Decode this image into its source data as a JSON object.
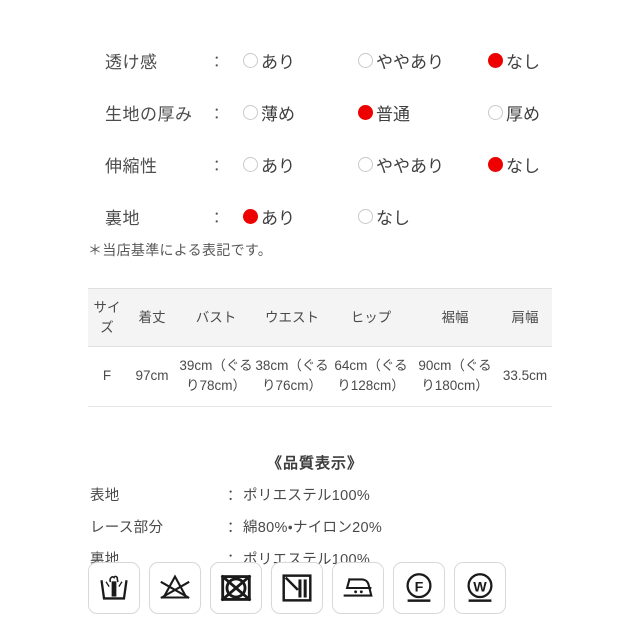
{
  "attributes": [
    {
      "name": "sheerness",
      "label": "透け感",
      "colon": "：",
      "options": [
        {
          "text": "あり",
          "selected": false
        },
        {
          "text": "ややあり",
          "selected": false
        },
        {
          "text": "なし",
          "selected": true
        }
      ]
    },
    {
      "name": "thickness",
      "label": "生地の厚み",
      "colon": "：",
      "options": [
        {
          "text": "薄め",
          "selected": false
        },
        {
          "text": "普通",
          "selected": true
        },
        {
          "text": "厚め",
          "selected": false
        }
      ]
    },
    {
      "name": "stretch",
      "label": "伸縮性",
      "colon": "：",
      "options": [
        {
          "text": "あり",
          "selected": false
        },
        {
          "text": "ややあり",
          "selected": false
        },
        {
          "text": "なし",
          "selected": true
        }
      ]
    },
    {
      "name": "lining",
      "label": "裏地",
      "colon": "：",
      "options": [
        {
          "text": "あり",
          "selected": true
        },
        {
          "text": "なし",
          "selected": false
        }
      ]
    }
  ],
  "footnote": "＊当店基準による表記です。",
  "size_table": {
    "headers": [
      "サイズ",
      "着丈",
      "バスト",
      "ウエスト",
      "ヒップ",
      "裾幅",
      "肩幅"
    ],
    "rows": [
      [
        "F",
        "97cm",
        "39cm（ぐるり78cm）",
        "38cm（ぐるり76cm）",
        "64cm（ぐるり128cm）",
        "90cm（ぐるり180cm）",
        "33.5cm"
      ]
    ]
  },
  "quality": {
    "title": "《品質表示》",
    "rows": [
      {
        "label": "表地",
        "colon": "：",
        "value": "ポリエステル100%"
      },
      {
        "label": "レース部分",
        "colon": "：",
        "value": "綿80%・ナイロン20%"
      },
      {
        "label": "裏地",
        "colon": "：",
        "value": "ポリエステル100%"
      }
    ]
  },
  "care_icons": [
    {
      "icon": "hand-wash-icon",
      "meaning": "手洗い"
    },
    {
      "icon": "do-not-bleach-icon",
      "meaning": "塩素系・酸素系漂白剤不可"
    },
    {
      "icon": "do-not-tumble-dry-icon",
      "meaning": "タンブル乾燥禁止"
    },
    {
      "icon": "drip-dry-in-shade-icon",
      "meaning": "陰干し つり干し"
    },
    {
      "icon": "iron-medium-icon",
      "meaning": "中温アイロン"
    },
    {
      "icon": "dryclean-f-mild-icon",
      "meaning": "石油系ドライクリーニング 弱"
    },
    {
      "icon": "wetclean-w-mild-icon",
      "meaning": "ウエットクリーニング 弱"
    }
  ],
  "colors": {
    "selected_red": "#ee0000",
    "unselected_gray": "#c9c9c9",
    "text": "#4a4a4a",
    "table_header_bg": "#f4f4f4"
  }
}
